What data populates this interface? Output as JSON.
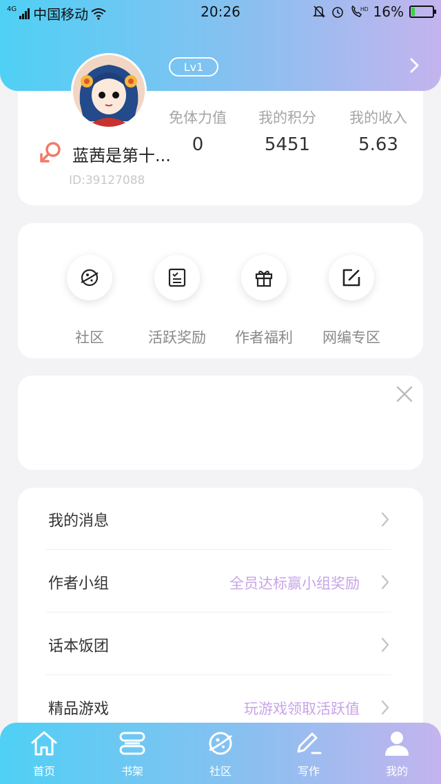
{
  "status_bar": {
    "network": "4G",
    "carrier": "中国移动",
    "time": "20:26",
    "battery_percent": "16%",
    "battery_level": 0.16
  },
  "header": {
    "level_badge": "Lv1"
  },
  "profile": {
    "username": "蓝茜是第十...",
    "user_id": "ID:39127088",
    "stats": [
      {
        "label": "免体力值",
        "value": "0"
      },
      {
        "label": "我的积分",
        "value": "5451"
      },
      {
        "label": "我的收入",
        "value": "5.63"
      }
    ]
  },
  "quick_actions": [
    {
      "label": "社区",
      "icon": "planet-icon"
    },
    {
      "label": "活跃奖励",
      "icon": "checklist-icon"
    },
    {
      "label": "作者福利",
      "icon": "gift-icon"
    },
    {
      "label": "网编专区",
      "icon": "edit-icon"
    }
  ],
  "menu": [
    {
      "label": "我的消息",
      "hint": ""
    },
    {
      "label": "作者小组",
      "hint": "全员达标赢小组奖励"
    },
    {
      "label": "话本饭团",
      "hint": ""
    },
    {
      "label": "精品游戏",
      "hint": "玩游戏领取活跃值"
    }
  ],
  "tabbar": [
    {
      "label": "首页",
      "icon": "home-icon"
    },
    {
      "label": "书架",
      "icon": "bookshelf-icon"
    },
    {
      "label": "社区",
      "icon": "planet-icon"
    },
    {
      "label": "写作",
      "icon": "pen-icon"
    },
    {
      "label": "我的",
      "icon": "user-icon"
    }
  ],
  "colors": {
    "gradient_start": "#4fd0f5",
    "gradient_end": "#c4b4ee",
    "hint_text": "#c8a4e8",
    "gender_icon": "#f07a6a"
  }
}
